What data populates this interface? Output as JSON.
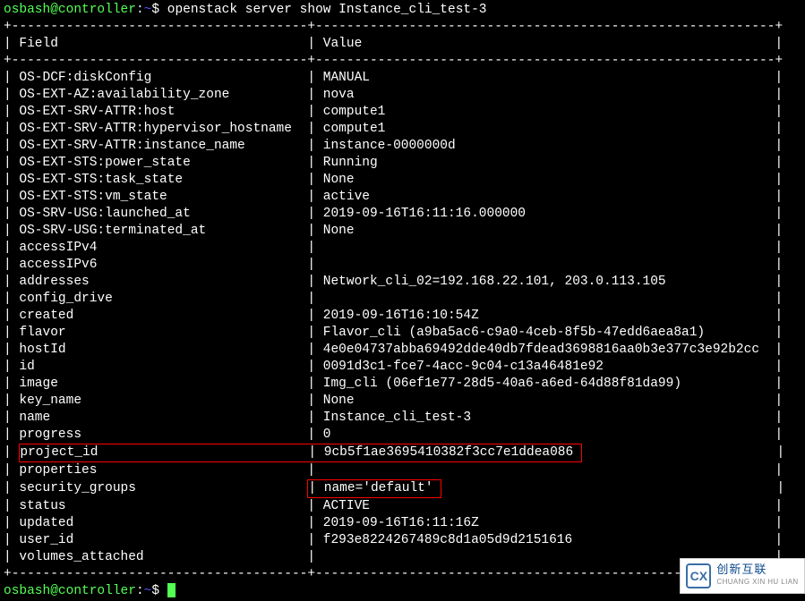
{
  "prompt": {
    "user_host": "osbash@controller",
    "colon": ":",
    "tilde": "~",
    "dollar": "$",
    "command": "openstack server show Instance_cli_test-3"
  },
  "separator": "+--------------------------------------+-----------------------------------------------------------+",
  "headers": {
    "field": "Field",
    "value": "Value"
  },
  "rows": [
    {
      "field": "OS-DCF:diskConfig",
      "value": "MANUAL"
    },
    {
      "field": "OS-EXT-AZ:availability_zone",
      "value": "nova"
    },
    {
      "field": "OS-EXT-SRV-ATTR:host",
      "value": "compute1"
    },
    {
      "field": "OS-EXT-SRV-ATTR:hypervisor_hostname",
      "value": "compute1"
    },
    {
      "field": "OS-EXT-SRV-ATTR:instance_name",
      "value": "instance-0000000d"
    },
    {
      "field": "OS-EXT-STS:power_state",
      "value": "Running"
    },
    {
      "field": "OS-EXT-STS:task_state",
      "value": "None"
    },
    {
      "field": "OS-EXT-STS:vm_state",
      "value": "active"
    },
    {
      "field": "OS-SRV-USG:launched_at",
      "value": "2019-09-16T16:11:16.000000"
    },
    {
      "field": "OS-SRV-USG:terminated_at",
      "value": "None"
    },
    {
      "field": "accessIPv4",
      "value": ""
    },
    {
      "field": "accessIPv6",
      "value": ""
    },
    {
      "field": "addresses",
      "value": "Network_cli_02=192.168.22.101, 203.0.113.105"
    },
    {
      "field": "config_drive",
      "value": ""
    },
    {
      "field": "created",
      "value": "2019-09-16T16:10:54Z"
    },
    {
      "field": "flavor",
      "value": "Flavor_cli (a9ba5ac6-c9a0-4ceb-8f5b-47edd6aea8a1)"
    },
    {
      "field": "hostId",
      "value": "4e0e04737abba69492dde40db7fdead3698816aa0b3e377c3e92b2cc"
    },
    {
      "field": "id",
      "value": "0091d3c1-fce7-4acc-9c04-c13a46481e92"
    },
    {
      "field": "image",
      "value": "Img_cli (06ef1e77-28d5-40a6-a6ed-64d88f81da99)"
    },
    {
      "field": "key_name",
      "value": "None"
    },
    {
      "field": "name",
      "value": "Instance_cli_test-3"
    },
    {
      "field": "progress",
      "value": "0"
    },
    {
      "field": "project_id",
      "value": "9cb5f1ae3695410382f3cc7e1ddea086",
      "highlight": true
    },
    {
      "field": "properties",
      "value": ""
    },
    {
      "field": "security_groups",
      "value": "name='default'",
      "value_highlight": true
    },
    {
      "field": "status",
      "value": "ACTIVE"
    },
    {
      "field": "updated",
      "value": "2019-09-16T16:11:16Z"
    },
    {
      "field": "user_id",
      "value": "f293e8224267489c8d1a05d9d2151616"
    },
    {
      "field": "volumes_attached",
      "value": ""
    }
  ],
  "field_width": 36,
  "value_width": 57,
  "badge": {
    "logo": "CX",
    "cn": "创新互联",
    "en": "CHUANG XIN HU LIAN"
  }
}
